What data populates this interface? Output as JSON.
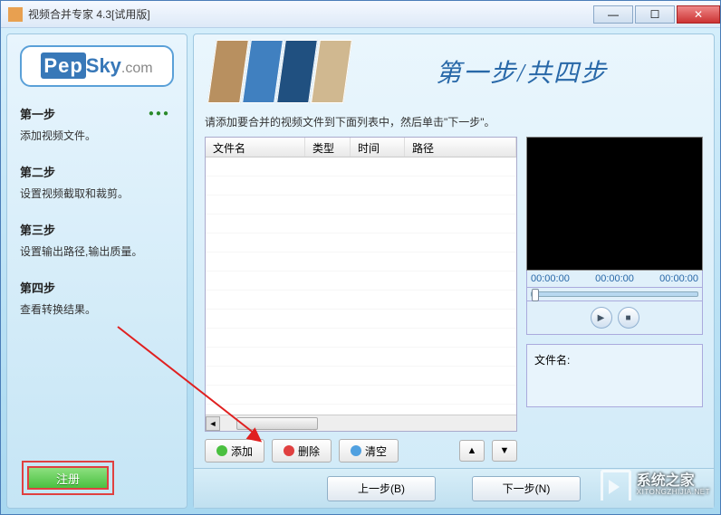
{
  "window": {
    "title": "视频合并专家 4.3[试用版]"
  },
  "logo": {
    "brand_pep": "Pep",
    "brand_sky": "Sky",
    "brand_suffix": ".com"
  },
  "sidebar": {
    "steps": [
      {
        "title": "第一步",
        "desc": "添加视频文件。",
        "active": true
      },
      {
        "title": "第二步",
        "desc": "设置视频截取和裁剪。",
        "active": false
      },
      {
        "title": "第三步",
        "desc": "设置输出路径,输出质量。",
        "active": false
      },
      {
        "title": "第四步",
        "desc": "查看转换结果。",
        "active": false
      }
    ],
    "register_label": "注册"
  },
  "banner": {
    "title": "第一步/共四步"
  },
  "main": {
    "instruction": "请添加要合并的视频文件到下面列表中，然后单击\"下一步\"。",
    "table": {
      "headers": {
        "name": "文件名",
        "type": "类型",
        "time": "时间",
        "path": "路径"
      }
    },
    "buttons": {
      "add": "添加",
      "delete": "删除",
      "clear": "清空"
    }
  },
  "preview": {
    "times": [
      "00:00:00",
      "00:00:00",
      "00:00:00"
    ],
    "filename_label": "文件名:"
  },
  "nav": {
    "prev": "上一步(B)",
    "next": "下一步(N)"
  },
  "watermark": {
    "name": "系统之家",
    "url": "XITONGZHIJIA.NET"
  }
}
